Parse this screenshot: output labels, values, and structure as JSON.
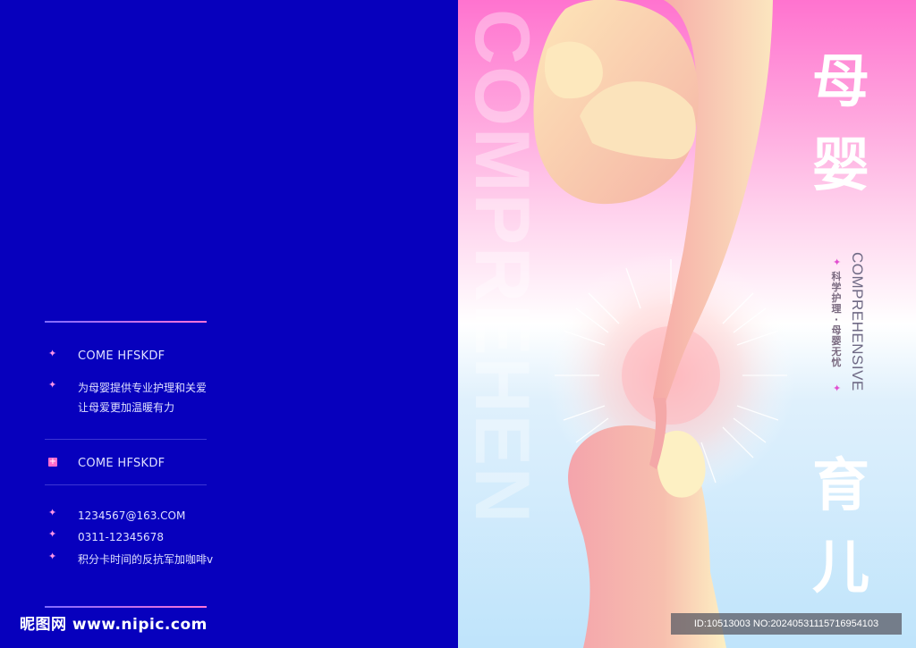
{
  "left": {
    "items": [
      {
        "icon": "sparkle-icon",
        "text": "COME HFSKDF"
      },
      {
        "icon": "sparkle-icon",
        "lines": [
          "为母婴提供专业护理和关爱",
          "让母爱更加温暖有力"
        ]
      },
      {
        "icon": "plus-square-icon",
        "text": "COME HFSKDF"
      },
      {
        "icon": "sparkle-icon",
        "text": "1234567@163.COM"
      },
      {
        "icon": "sparkle-icon",
        "text": "0311-12345678"
      },
      {
        "icon": "sparkle-icon",
        "text": "积分卡时间的反抗军加咖啡v"
      }
    ],
    "watermark": "昵图网 www.nipic.com"
  },
  "right": {
    "bg_word": "COMPREHEN",
    "title": [
      "母",
      "婴",
      "育",
      "儿"
    ],
    "vertical_en": "COMPREHENSIVE",
    "vertical_cn": "科学护理·母婴无忧",
    "id_text": "ID:10513003 NO:20240531115716954103"
  },
  "colors": {
    "left_bg": "#0700bd",
    "accent_pink": "#ff73cf",
    "skin": "#f7b4a8",
    "light_blue": "#bfe4fb"
  }
}
